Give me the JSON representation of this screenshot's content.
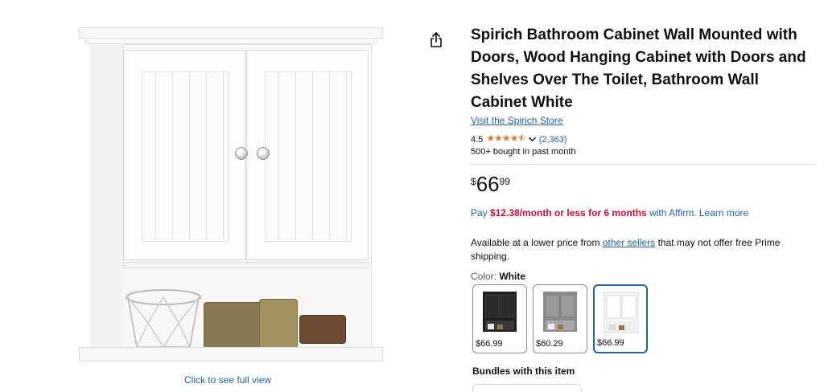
{
  "product": {
    "title": "Spirich Bathroom Cabinet Wall Mounted with Doors, Wood Hanging Cabinet with Doors and Shelves Over The Toilet, Bathroom Wall Cabinet White",
    "store_link": "Visit the Spirich Store",
    "rating": "4.5",
    "rating_value": 4.5,
    "stars": "★★★★⯪",
    "review_count": "(2,363)",
    "bought": "500+ bought in past month"
  },
  "image": {
    "full_view_label": "Click to see full view"
  },
  "price": {
    "symbol": "$",
    "whole": "66",
    "fraction": "99"
  },
  "affirm": {
    "prefix": "Pay ",
    "amount": "$12.38/month or less for 6 months",
    "suffix": " with Affirm. Learn more"
  },
  "availability": {
    "prefix": "Available at a lower price from ",
    "link": "other sellers",
    "suffix": " that may not offer free Prime shipping."
  },
  "color": {
    "label": "Color: ",
    "selected": "White",
    "options": [
      {
        "price": "$66.99",
        "cabinet_color": "#1e1e1e"
      },
      {
        "price": "$60.29",
        "cabinet_color": "#8c8c8c"
      },
      {
        "price": "$66.99",
        "cabinet_color": "#f6f6f6"
      }
    ],
    "selected_index": 2
  },
  "bundles": {
    "heading": "Bundles with this item"
  },
  "colors": {
    "link": "#2162a1",
    "star": "#de7921",
    "affirm_amount": "#cc0c39",
    "selected_border": "#2162a1"
  },
  "icons": {
    "share": "share-icon",
    "chevron": "chevron-down-icon"
  }
}
